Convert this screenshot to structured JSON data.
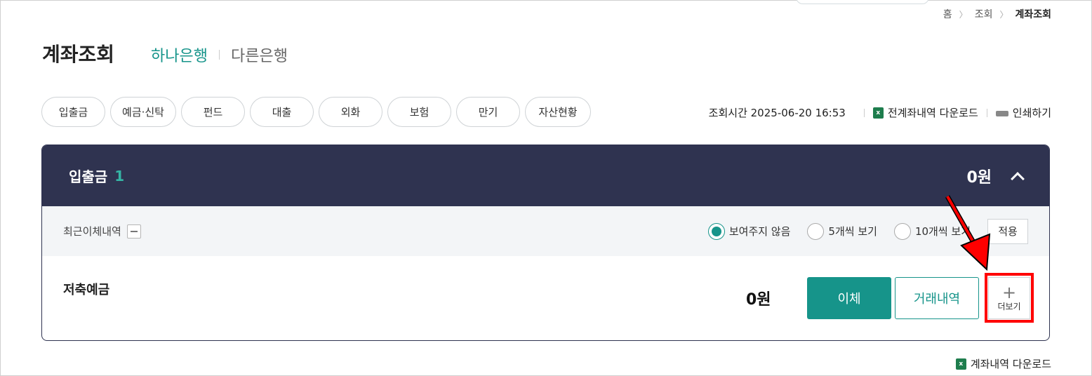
{
  "breadcrumb": {
    "home": "홈",
    "level1": "조회",
    "current": "계좌조회"
  },
  "page": {
    "title": "계좌조회"
  },
  "bank_tabs": {
    "active": "하나은행",
    "other": "다른은행"
  },
  "category_tabs": [
    "입출금",
    "예금·신탁",
    "펀드",
    "대출",
    "외화",
    "보험",
    "만기",
    "자산현황"
  ],
  "tools": {
    "query_time": "조회시간 2025-06-20 16:53",
    "download_all": "전계좌내역 다운로드",
    "print": "인쇄하기"
  },
  "panel": {
    "name": "입출금",
    "count": "1",
    "total": "0원",
    "recent_label": "최근이체내역",
    "radio_options": [
      "보여주지 않음",
      "5개씩 보기",
      "10개씩 보기"
    ],
    "apply": "적용",
    "account": {
      "name": "저축예금",
      "balance": "0원",
      "transfer": "이체",
      "history": "거래내역",
      "more": "더보기"
    }
  },
  "bottom": {
    "download": "계좌내역 다운로드"
  },
  "colors": {
    "accent": "#16948a",
    "header": "#2f3350",
    "highlight": "#ff0000"
  }
}
